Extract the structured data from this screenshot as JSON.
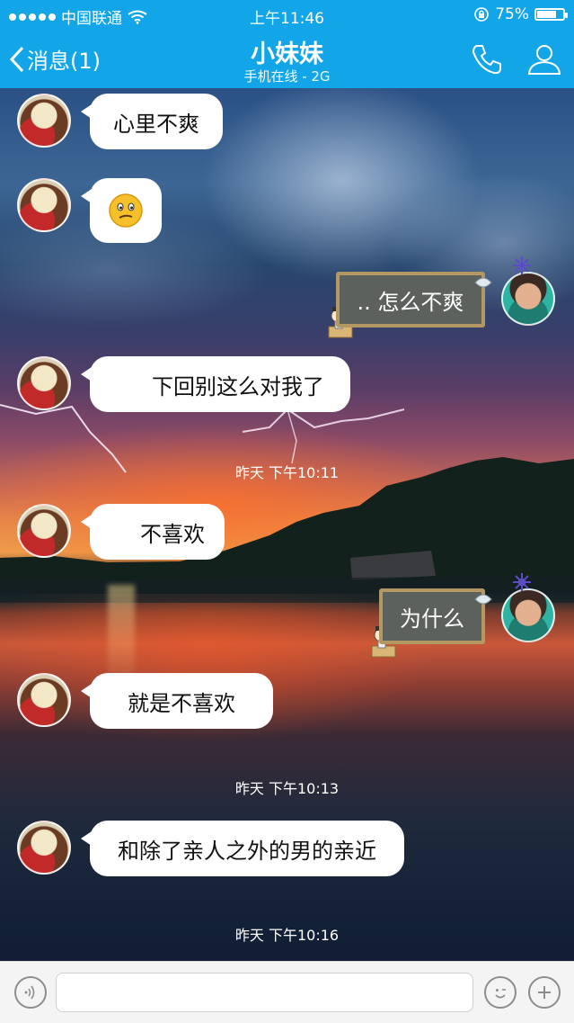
{
  "status_bar": {
    "carrier": "中国联通",
    "time": "上午11:46",
    "battery": "75%",
    "battery_level": 0.75,
    "icons": [
      "wifi-icon",
      "orientation-lock-icon",
      "battery-icon"
    ]
  },
  "nav": {
    "back_label": "消息(1)",
    "title": "小妹妹",
    "subtitle": "手机在线 - 2G",
    "icons": [
      "phone-icon",
      "profile-icon"
    ],
    "accent_color": "#12a6e8"
  },
  "messages": [
    {
      "side": "left",
      "text": "心里不爽"
    },
    {
      "side": "left",
      "text": "",
      "emoji": "confused-face-emoji"
    },
    {
      "side": "right",
      "text": ".. 怎么不爽"
    },
    {
      "side": "left",
      "text": "下回别这么对我了"
    },
    {
      "timestamp": "昨天 下午10:11"
    },
    {
      "side": "left",
      "text": "不喜欢"
    },
    {
      "side": "right",
      "text": "为什么"
    },
    {
      "side": "left",
      "text": "就是不喜欢"
    },
    {
      "timestamp": "昨天 下午10:13"
    },
    {
      "side": "left",
      "text": "和除了亲人之外的男的亲近"
    },
    {
      "timestamp": "昨天 下午10:16"
    }
  ],
  "input_bar": {
    "value": "",
    "placeholder": "",
    "icons": [
      "voice-icon",
      "emoji-icon",
      "plus-icon"
    ]
  }
}
